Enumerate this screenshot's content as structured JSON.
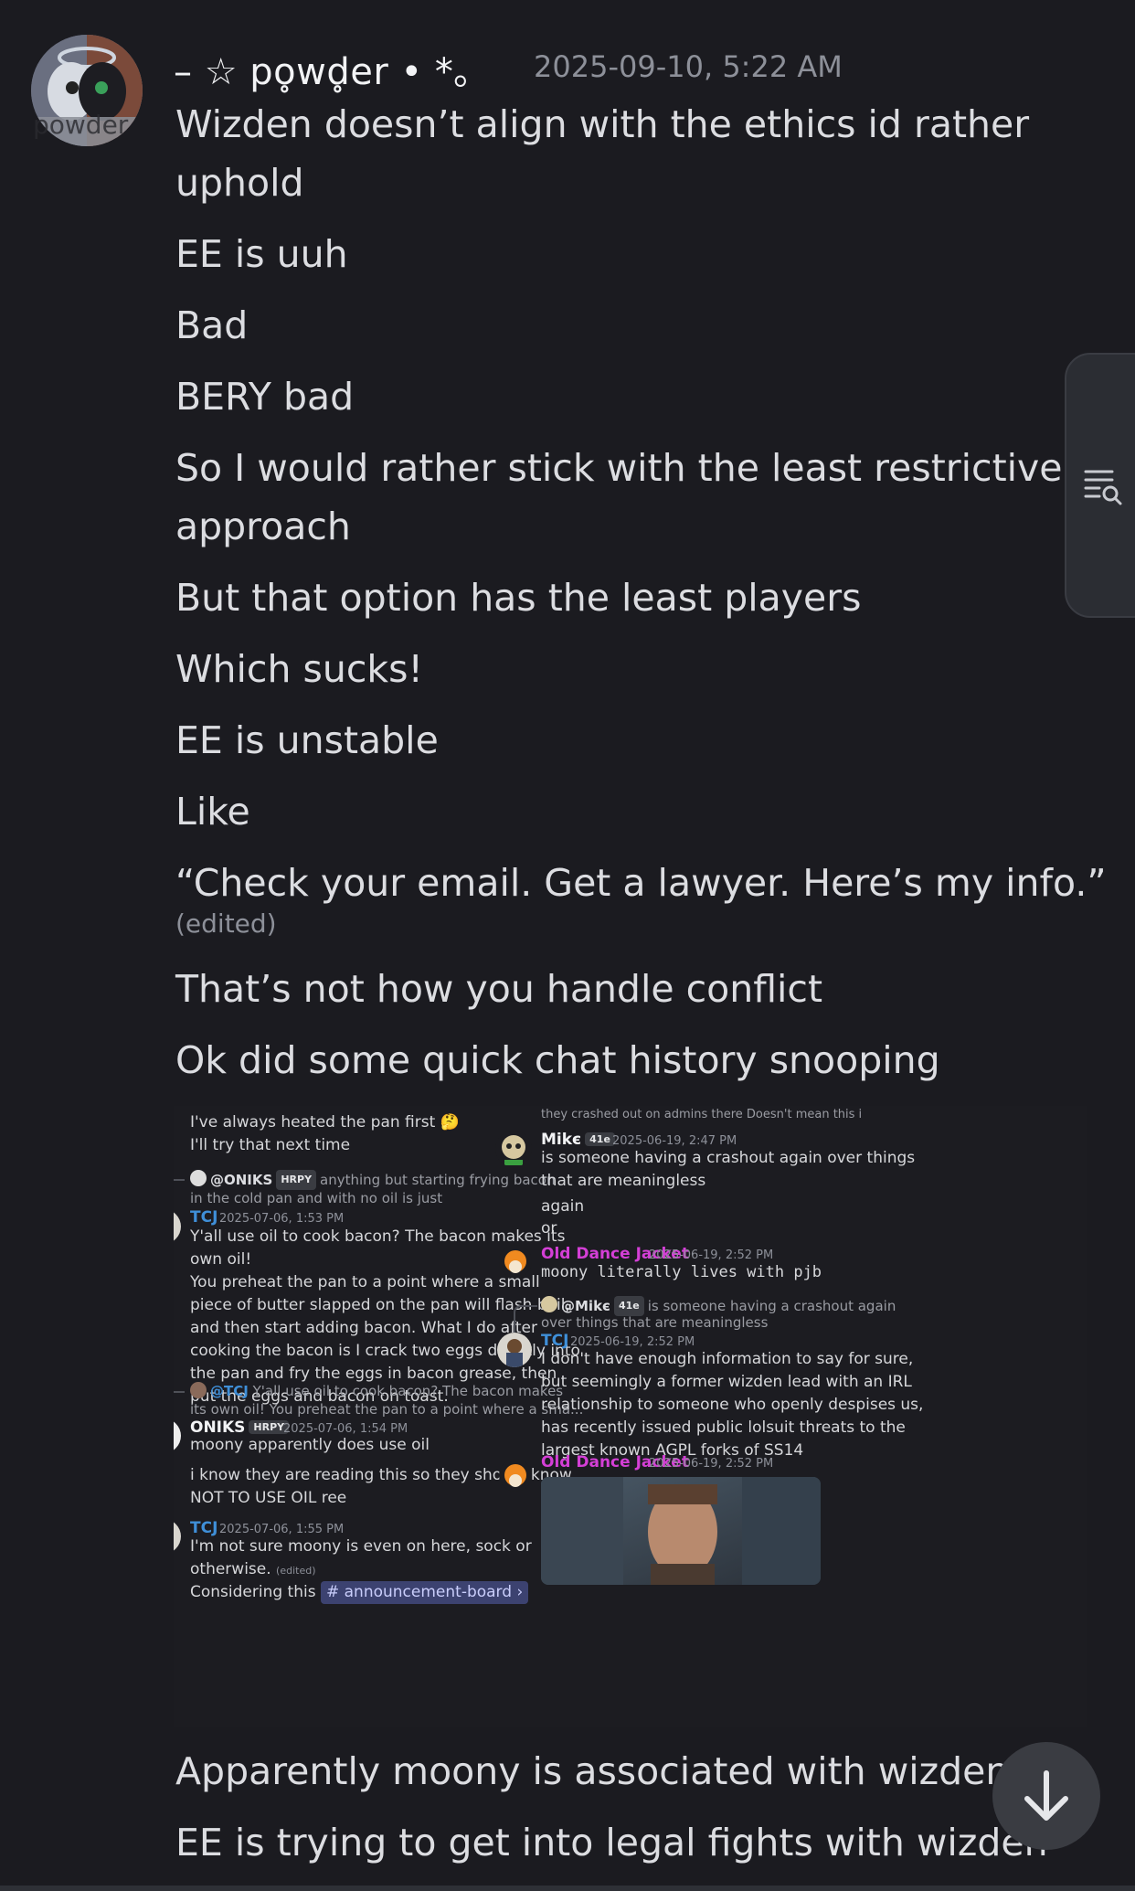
{
  "message": {
    "author": "– ☆ po̥wd̥er • *｡",
    "timestamp": "2025-09-10, 5:22 AM",
    "avatar_label": "powder",
    "lines": [
      "Wizden doesn’t align with the ethics id rather",
      "uphold",
      "EE is uuh",
      "Bad",
      "BERY bad",
      "So I would rather stick with the least restrictive",
      "approach",
      "But that option has the least players",
      "Which sucks!",
      "EE is unstable",
      "Like",
      "“Check your email. Get a lawyer. Here’s my info.”",
      "That’s not how you handle conflict",
      "Ok did some quick chat history snooping"
    ],
    "edited_label": "(edited)",
    "after_lines": [
      "Apparently moony is associated with wizden",
      "EE is trying to get into legal fights with wizden"
    ]
  },
  "screenshot": {
    "left": {
      "top_text_1": "I've always heated the pan first 🤔",
      "top_text_2": "I'll try that next time",
      "reply1": {
        "user": "@ONIKS",
        "badge": "HRPY",
        "text1": "anything but starting frying bacon",
        "text2": "in the cold pan and with no oil is just"
      },
      "msg1": {
        "author": "TCJ",
        "time": "2025-07-06, 1:53 PM",
        "lines": [
          "Y'all use oil to cook bacon? The bacon makes its",
          "own oil!",
          "You preheat the pan to a point where a small",
          "piece of butter slapped on the pan will flash boil,",
          "and then start adding bacon. What I do after",
          "cooking the bacon is I crack two eggs directly into",
          "the pan and fry the eggs in bacon grease, then",
          "put the eggs and bacon on toast."
        ]
      },
      "reply2": {
        "user": "@TCJ",
        "text1": "Y'all use oil to cook bacon? The bacon makes",
        "text2": "its own oil! You preheat the pan to a point where a sma..."
      },
      "msg2": {
        "author": "ONIKS",
        "badge": "HRPY",
        "time": "2025-07-06, 1:54 PM",
        "line1": "moony apparently does use oil",
        "line2": "i know they are reading this so they should know",
        "line3": "NOT TO USE OIL ree"
      },
      "msg3": {
        "author": "TCJ",
        "time": "2025-07-06, 1:55 PM",
        "line1": "I'm not sure moony is even on here, sock or",
        "line2": "otherwise.",
        "edited": "(edited)",
        "line3_prefix": "Considering this",
        "channel": "# announcement-board ›"
      }
    },
    "right": {
      "cut_text": "they crashed out on admins there Doesn't mean this i",
      "msg1": {
        "author": "Mikє",
        "badge": "41e",
        "time": "2025-06-19, 2:47 PM",
        "lines": [
          "is someone having a crashout again over things",
          "that are meaningless"
        ],
        "line_again": "again",
        "line_or": "or"
      },
      "msg2": {
        "author": "Old Dance Jacket",
        "time": "2025-06-19, 2:52 PM",
        "text": "moony literally lives with pjb"
      },
      "reply": {
        "user": "@Mikє",
        "badge": "41e",
        "text1": "is someone having a crashout again",
        "text2": "over things that are meaningless"
      },
      "msg3": {
        "author": "TCJ",
        "time": "2025-06-19, 2:52 PM",
        "lines": [
          "I don't have enough information to say for sure,",
          "but seemingly a former wizden lead with an IRL",
          "relationship to someone who openly despises us,",
          "has recently issued public lolsuit threats to the",
          "largest known AGPL forks of SS14"
        ]
      },
      "msg4": {
        "author": "Old Dance Jacket",
        "time": "2025-06-19, 2:52 PM"
      }
    }
  },
  "colors": {
    "background": "#1b1b20",
    "tcj": "#3f8fd8",
    "oniks": "#f2f3f5",
    "old_dance_jacket": "#d43fd6",
    "mike": "#f2f3f5"
  },
  "icons": {
    "side_tab": "search-list-icon",
    "scroll": "arrow-down-icon"
  }
}
